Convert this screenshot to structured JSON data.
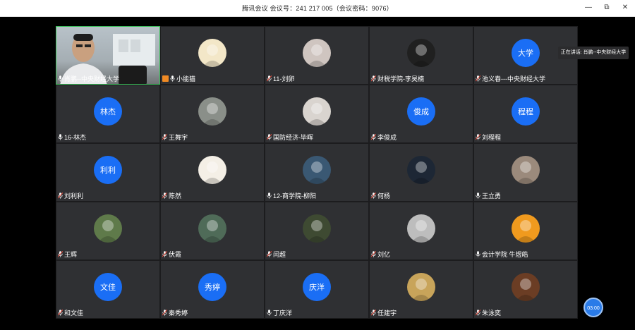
{
  "window": {
    "title": "腾讯会议  会议号：241 217 005（会议密码：9076）",
    "minimize_icon": "minimize-icon",
    "restore_icon": "restore-icon",
    "close_icon": "close-icon"
  },
  "speaking_indicator": "正在讲话: 肖鹏--中央财经大学",
  "timer": "03:00",
  "participants": [
    {
      "name": "肖鹏--中央财经大学",
      "kind": "video",
      "mic": "on",
      "active": true
    },
    {
      "name": "小能猫",
      "kind": "photo",
      "mic": "on",
      "badge": "host",
      "avatar_color": "#f3e7c8"
    },
    {
      "name": "11-刘卵",
      "kind": "photo",
      "mic": "off",
      "avatar_color": "#cfc5c0"
    },
    {
      "name": "财税学院-李昊楠",
      "kind": "photo",
      "mic": "off",
      "avatar_color": "#202020"
    },
    {
      "name": "池义春---中央财经大学",
      "kind": "text",
      "mic": "off",
      "avatar_text": "大学"
    },
    {
      "name": "16-林杰",
      "kind": "text",
      "mic": "on",
      "avatar_text": "林杰"
    },
    {
      "name": "王舞宇",
      "kind": "photo",
      "mic": "off",
      "avatar_color": "#8a8f89"
    },
    {
      "name": "国防经济-毕晖",
      "kind": "photo",
      "mic": "off",
      "avatar_color": "#d9d4cf"
    },
    {
      "name": "李俊成",
      "kind": "text",
      "mic": "off",
      "avatar_text": "俊成"
    },
    {
      "name": "刘程程",
      "kind": "text",
      "mic": "off",
      "avatar_text": "程程"
    },
    {
      "name": "刘利利",
      "kind": "text",
      "mic": "off",
      "avatar_text": "利利"
    },
    {
      "name": "陈然",
      "kind": "photo",
      "mic": "off",
      "avatar_color": "#f4efe6"
    },
    {
      "name": "12-商学院-柳阳",
      "kind": "photo",
      "mic": "on",
      "avatar_color": "#3a5873"
    },
    {
      "name": "何杨",
      "kind": "photo",
      "mic": "off",
      "avatar_color": "#1d2735"
    },
    {
      "name": "王立勇",
      "kind": "photo",
      "mic": "on",
      "avatar_color": "#9b8a7c"
    },
    {
      "name": "王辉",
      "kind": "photo",
      "mic": "off",
      "avatar_color": "#5f7a4a"
    },
    {
      "name": "伏霞",
      "kind": "photo",
      "mic": "off",
      "avatar_color": "#4f6b58"
    },
    {
      "name": "闫超",
      "kind": "photo",
      "mic": "off",
      "avatar_color": "#3e4a32"
    },
    {
      "name": "刘亿",
      "kind": "photo",
      "mic": "off",
      "avatar_color": "#bdbdbd"
    },
    {
      "name": "会计学院 牛煜皓",
      "kind": "photo",
      "mic": "on",
      "avatar_color": "#f09a1e"
    },
    {
      "name": "和文佳",
      "kind": "text",
      "mic": "off",
      "avatar_text": "文佳"
    },
    {
      "name": "秦秀婷",
      "kind": "text",
      "mic": "off",
      "avatar_text": "秀婷"
    },
    {
      "name": "丁庆洋",
      "kind": "text",
      "mic": "on",
      "avatar_text": "庆洋"
    },
    {
      "name": "任建宇",
      "kind": "photo",
      "mic": "off",
      "avatar_color": "#c8a45a"
    },
    {
      "name": "朱泳奕",
      "kind": "photo",
      "mic": "off",
      "avatar_color": "#6b3d24"
    }
  ]
}
